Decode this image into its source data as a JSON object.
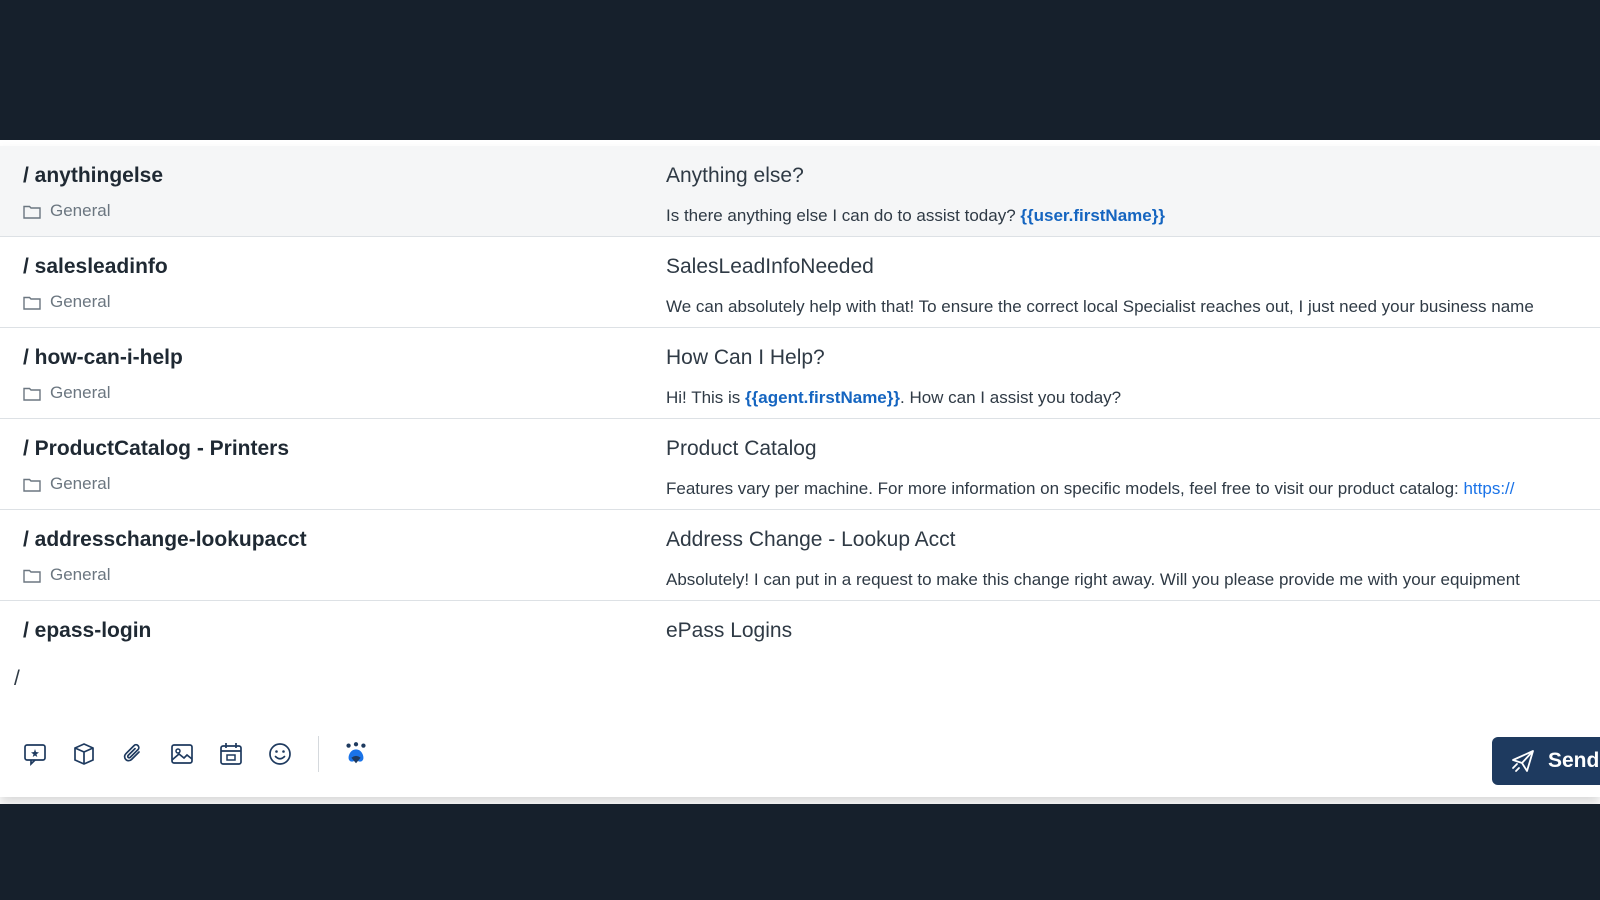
{
  "snippets": [
    {
      "shortcut": "/ anythingelse",
      "category": "General",
      "title": "Anything else?",
      "body_pre": "Is there anything else I can do to assist today? ",
      "body_var": "{{user.firstName}}",
      "body_post": ""
    },
    {
      "shortcut": "/ salesleadinfo",
      "category": "General",
      "title": "SalesLeadInfoNeeded",
      "body_pre": "We can absolutely help with that! To ensure the correct local Specialist reaches out, I just need your business name",
      "body_var": "",
      "body_post": ""
    },
    {
      "shortcut": "/ how-can-i-help",
      "category": "General",
      "title": "How Can I Help?",
      "body_pre": "Hi! This is ",
      "body_var": "{{agent.firstName}}",
      "body_post": ". How can I assist you today?"
    },
    {
      "shortcut": "/ ProductCatalog - Printers",
      "category": "General",
      "title": "Product Catalog",
      "body_pre": "Features vary per machine. For more information on specific models, feel free to visit our product catalog: ",
      "body_var": "",
      "body_link": "https://",
      "body_post": ""
    },
    {
      "shortcut": "/ addresschange-lookupacct",
      "category": "General",
      "title": "Address Change - Lookup Acct",
      "body_pre": "Absolutely! I can put in a request to make this change right away. Will you please provide me with your equipment",
      "body_var": "",
      "body_post": ""
    },
    {
      "shortcut": "/ epass-login",
      "category": "",
      "title": "ePass Logins",
      "body_pre": "",
      "body_var": "",
      "body_post": ""
    }
  ],
  "composer": {
    "input_value": "/",
    "send_label": "Send"
  },
  "toolbar_icons": [
    "canned-response-icon",
    "knowledge-base-icon",
    "paperclip-icon",
    "image-icon",
    "calendar-icon",
    "emoji-icon",
    "ai-assist-icon"
  ],
  "colors": {
    "background": "#16202c",
    "variable": "#1565c0",
    "send_button": "#1e3a5f",
    "active_row": "#f5f6f7"
  }
}
